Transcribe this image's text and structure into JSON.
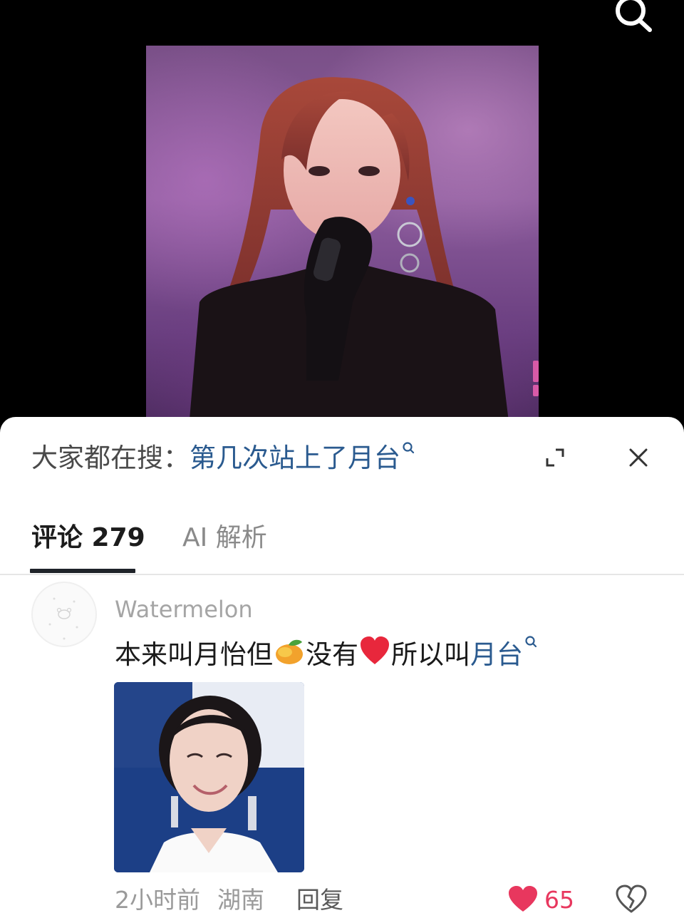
{
  "video": {
    "search_icon": "search-icon"
  },
  "sheet": {
    "hot_search": {
      "prefix": "大家都在搜：",
      "query": "第几次站上了月台",
      "query_icon": "search-icon"
    },
    "expand_icon": "expand-icon",
    "close_icon": "close-icon"
  },
  "tabs": [
    {
      "label": "评论 279",
      "active": true
    },
    {
      "label": "AI 解析",
      "active": false
    }
  ],
  "comment": {
    "username": "Watermelon",
    "text_parts": {
      "part1": "本来叫月怡但",
      "emoji1": "mango-emoji",
      "part2": "没有",
      "emoji2": "red-heart-emoji",
      "part3": "所以叫",
      "link": "月台",
      "link_icon": "search-icon"
    },
    "time": "2小时前",
    "location": "湖南",
    "reply_label": "回复",
    "like_count": "65",
    "like_icon": "heart-icon",
    "dislike_icon": "broken-heart-icon"
  },
  "colors": {
    "link": "#2a5a8f",
    "like": "#e8375e",
    "tab_underline": "#1f2329"
  }
}
